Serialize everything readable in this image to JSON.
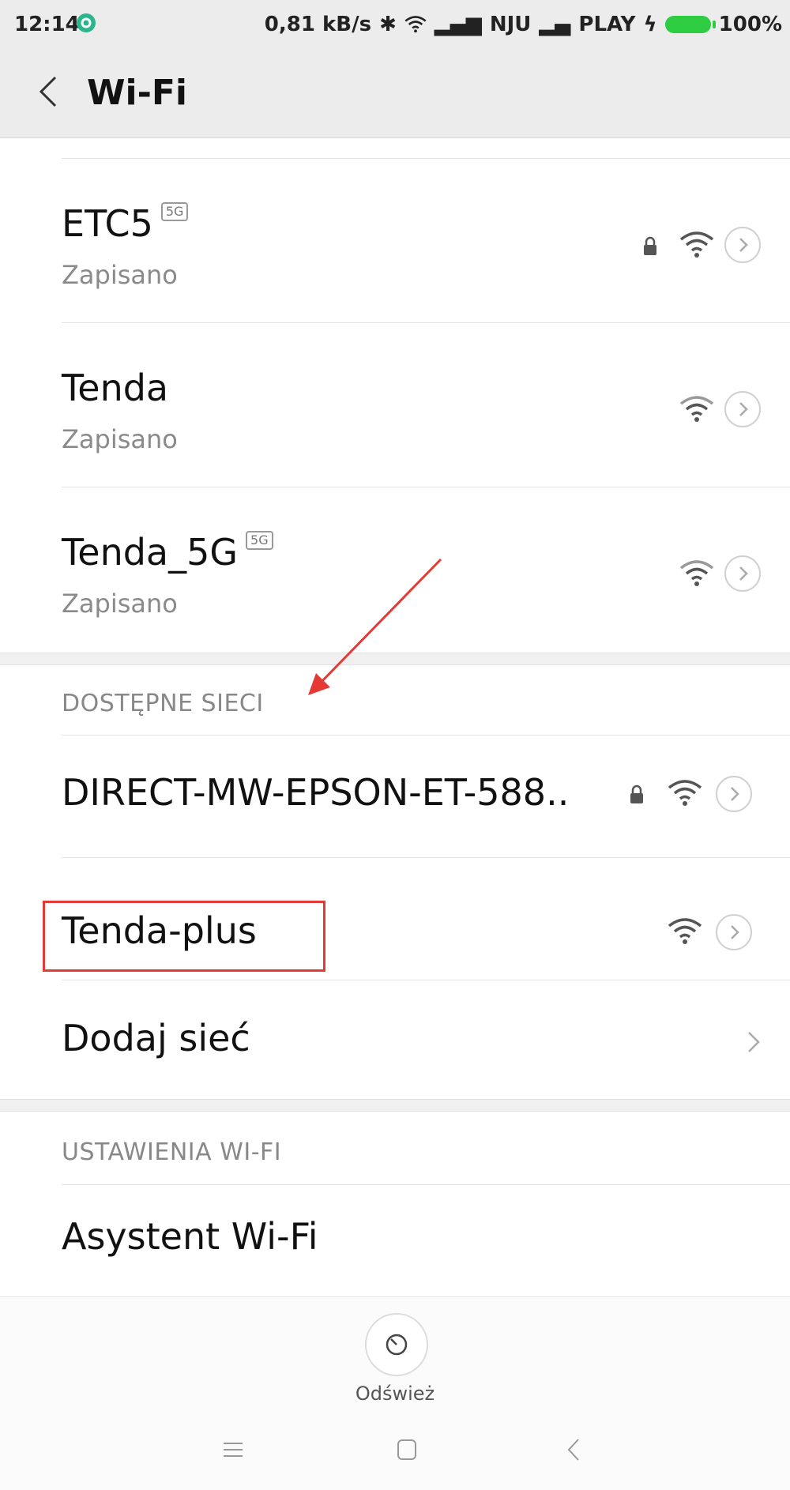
{
  "status_bar": {
    "time": "12:14",
    "network_speed": "0,81 kB/s",
    "carrier1": "NJU",
    "carrier2": "PLAY",
    "battery": "100%",
    "battery_color": "#2ecc40"
  },
  "header": {
    "title": "Wi-Fi",
    "back_icon": "chevron-left-icon"
  },
  "saved_networks": [
    {
      "name": "ETC5",
      "badge": "5G",
      "status": "Zapisano",
      "secured": true
    },
    {
      "name": "Tenda",
      "badge": "",
      "status": "Zapisano",
      "secured": false
    },
    {
      "name": "Tenda_5G",
      "badge": "5G",
      "status": "Zapisano",
      "secured": false
    }
  ],
  "available_section": {
    "header": "DOSTĘPNE SIECI",
    "networks": [
      {
        "name": "DIRECT-MW-EPSON-ET-588..",
        "secured": true
      },
      {
        "name": "Tenda-plus",
        "secured": false
      }
    ],
    "add_network": "Dodaj sieć"
  },
  "settings_section": {
    "header": "USTAWIENIA WI-FI",
    "assistant": "Asystent Wi-Fi"
  },
  "refresh": {
    "label": "Odśwież"
  },
  "annotations": {
    "highlight_color": "#e53935"
  }
}
